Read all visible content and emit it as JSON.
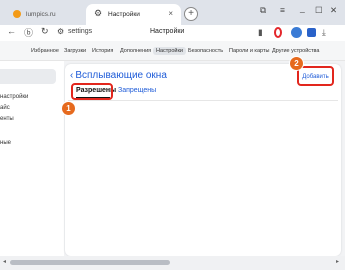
{
  "tabs": [
    {
      "title": "lumpics.ru",
      "icon": "orange-circle-icon"
    },
    {
      "title": "Настройки",
      "icon": "gear-icon"
    }
  ],
  "new_tab_symbol": "+",
  "tab_close_symbol": "×",
  "window_controls": {
    "bookmark": "⧉",
    "menu": "≡",
    "minimize": "_",
    "maximize": "☐",
    "close": "✕"
  },
  "address_bar": {
    "back": "←",
    "secure": "ⓑ",
    "reload": "↻",
    "url": "settings",
    "page_title": "Настройки",
    "bookmark_icon": "▮"
  },
  "nav": {
    "items": [
      "Избранное",
      "Загрузки",
      "История",
      "Дополнения",
      "Настройки",
      "Безопасность",
      "Пароли и карты",
      "Другие устройства"
    ],
    "active_index": 4
  },
  "sidebar": {
    "items": [
      "настройки",
      "айс",
      "енты",
      "ные"
    ]
  },
  "page": {
    "back_chevron": "‹",
    "title": "Всплывающие окна",
    "tabs": {
      "allowed": "Разрешены",
      "blocked": "Запрещены"
    },
    "add_button": "Добавить"
  },
  "callouts": {
    "one": "1",
    "two": "2"
  },
  "scroll": {
    "left": "◂",
    "right": "▸"
  },
  "colors": {
    "accent": "#1f5cd8",
    "highlight": "#e2261d",
    "badge": "#e66a1e"
  }
}
